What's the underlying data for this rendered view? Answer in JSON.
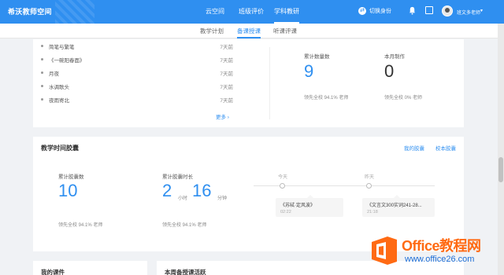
{
  "topbar": {
    "brand": "希沃教师空间",
    "nav": [
      {
        "label": "云空间"
      },
      {
        "label": "班级评价"
      },
      {
        "label": "学科教研"
      }
    ],
    "switch_identity": "切换身份",
    "user_name": "班文多老师"
  },
  "subtabs": [
    {
      "label": "教学计划"
    },
    {
      "label": "备课授课"
    },
    {
      "label": "听课评课"
    }
  ],
  "recent_list": [
    {
      "title": "简笔与繁笔",
      "time": "7天前"
    },
    {
      "title": "《一碗阳春面》",
      "time": "7天前"
    },
    {
      "title": "月夜",
      "time": "7天前"
    },
    {
      "title": "水调歌头",
      "time": "7天前"
    },
    {
      "title": "夜雨寄北",
      "time": "7天前"
    }
  ],
  "more_label": "更多 ›",
  "stats1": {
    "left": {
      "label": "累计数量数",
      "value": "9",
      "sub": "领先全校 94.1% 老师"
    },
    "right": {
      "label": "本月制作",
      "value": "0",
      "sub": "领先全校 0% 老师"
    }
  },
  "capsule": {
    "title": "教学时间胶囊",
    "link_mine": "我的胶囊",
    "link_school": "校本胶囊",
    "count_label": "累计胶囊数",
    "count_value": "10",
    "count_sub": "领先全校 94.1% 老师",
    "duration_label": "累计胶囊时长",
    "hours": "2",
    "hours_unit": "小时",
    "minutes": "16",
    "minutes_unit": "分钟",
    "duration_sub": "领先全校 94.1% 老师",
    "timeline": [
      {
        "day": "今天",
        "name": "《苏轼·定风波》",
        "time": "02:22"
      },
      {
        "day": "昨天",
        "name": "《文言文300实词241-28...",
        "time": "21:18"
      }
    ]
  },
  "bottom": {
    "left_title": "我的课件",
    "right_title": "本周备授课活跃"
  },
  "watermark": {
    "line1": "Office教程网",
    "line2": "www.office26.com"
  },
  "colors": {
    "primary": "#2f8ff0",
    "watermark_orange": "#ff6a13",
    "watermark_blue": "#1f6fd6"
  }
}
